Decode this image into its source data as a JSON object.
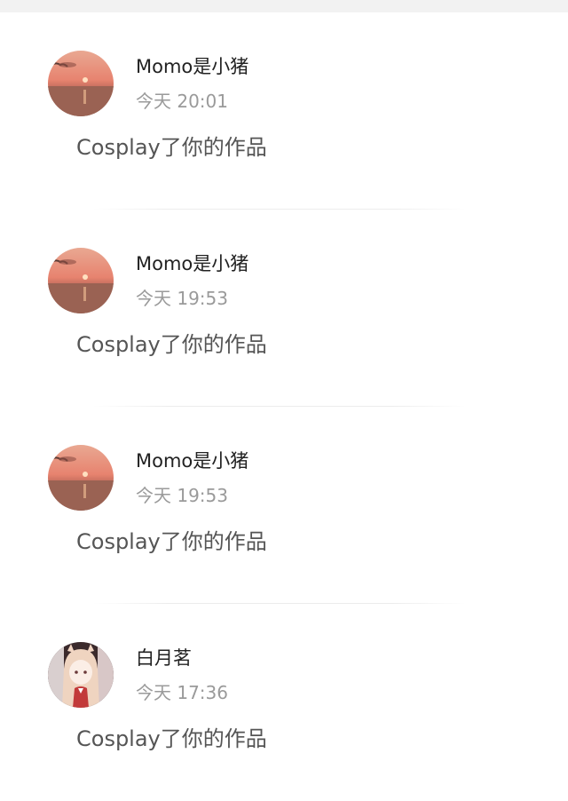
{
  "notifications": [
    {
      "username": "Momo是小猪",
      "time": "今天 20:01",
      "message": "Cosplay了你的作品",
      "avatar": "sunset-avatar"
    },
    {
      "username": "Momo是小猪",
      "time": "今天 19:53",
      "message": "Cosplay了你的作品",
      "avatar": "sunset-avatar"
    },
    {
      "username": "Momo是小猪",
      "time": "今天 19:53",
      "message": "Cosplay了你的作品",
      "avatar": "sunset-avatar"
    },
    {
      "username": "白月茗",
      "time": "今天 17:36",
      "message": "Cosplay了你的作品",
      "avatar": "anime-girl-avatar"
    }
  ],
  "colors": {
    "username": "#222222",
    "time": "#9a9a9a",
    "message": "#555555",
    "divider": "#ececec",
    "topbar": "#f2f2f2"
  }
}
